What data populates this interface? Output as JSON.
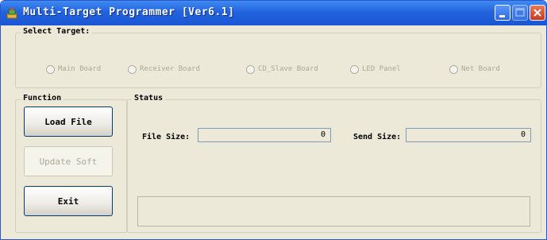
{
  "window": {
    "title": "Multi-Target Programmer [Ver6.1]",
    "icons": [
      "app-icon",
      "minimize-icon",
      "maximize-icon",
      "close-icon"
    ]
  },
  "select_target": {
    "label": "Select Target:",
    "options": [
      {
        "label": "Main Board"
      },
      {
        "label": "Receiver Board"
      },
      {
        "label": "CD_Slave Board"
      },
      {
        "label": "LED Panel"
      },
      {
        "label": "Net Board"
      }
    ]
  },
  "function": {
    "label": "Function",
    "buttons": {
      "load": "Load File",
      "update": "Update Soft",
      "exit": "Exit"
    }
  },
  "status": {
    "label": "Status",
    "file_size_label": "File Size:",
    "file_size_value": "0",
    "send_size_label": "Send Size:",
    "send_size_value": "0",
    "message": ""
  }
}
